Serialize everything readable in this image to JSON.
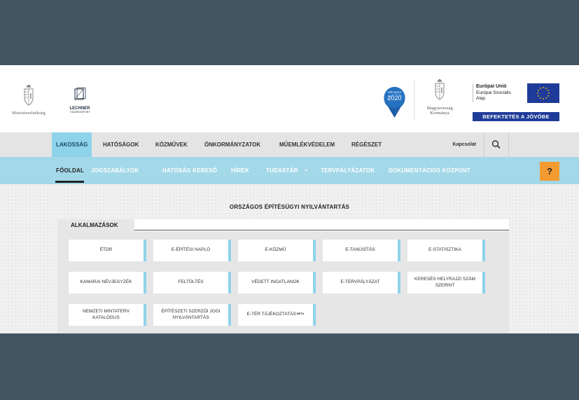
{
  "header": {
    "ministry_label": "Miniszterelnökség",
    "lechner_label": "LECHNER",
    "lechner_sub": "TUDÁSKÖZPONT",
    "szechenyi_label": "SZÉCHENYI",
    "szechenyi_year": "2020",
    "gov_label_1": "Magyarország",
    "gov_label_2": "Kormánya",
    "eu_title": "Európai Unió",
    "eu_line2": "Európai Szociális",
    "eu_line3": "Alap",
    "eu_banner": "BEFEKTETÉS A JÖVŐBE"
  },
  "topnav": {
    "items": [
      "LAKOSSÁG",
      "HATÓSÁGOK",
      "KÖZMŰVEK",
      "ÖNKORMÁNYZATOK",
      "MŰEMLÉKVÉDELEM",
      "RÉGÉSZET"
    ],
    "contact": "Kapcsolat"
  },
  "subnav": {
    "items": [
      "FŐOLDAL",
      "JOGSZABÁLYOK",
      "HATÓSÁG KERESŐ",
      "HÍREK",
      "TUDÁSTÁR",
      "TERVPÁLYÁZATOK",
      "DOKUMENTÁCIÓS KÖZPONT"
    ],
    "tudastar_chevron": "⌄",
    "help": "?"
  },
  "main": {
    "title": "ORSZÁGOS ÉPÍTÉSÜGYI NYILVÁNTARTÁS",
    "tab": "ALKALMAZÁSOK",
    "apps": [
      [
        "ÉTDR",
        "E-ÉPÍTÉSI NAPLÓ",
        "E-KÖZMŰ",
        "E-TANÚSÍTÁS",
        "E-STATISZTIKA"
      ],
      [
        "KAMARAI NÉVJEGYZÉK",
        "FELTÖLTÉS",
        "VÉDETT INGATLANOK",
        "E-TERVPÁLYÁZAT",
        "KERESÉS HELYRAJZI SZÁM SZERINT"
      ],
      [
        "NEMZETI MINTATERV KATALÓGUS",
        "ÉPÍTÉSZETI SZERZŐI JOGI NYILVÁNTARTÁS",
        "E-TÉR TÁJÉKOZTATÁS"
      ]
    ],
    "beta": "BÉTA"
  },
  "colors": {
    "accent": "#8ed3ea",
    "subnav": "#a3d8e8",
    "help": "#f39a31",
    "eu_blue": "#1f3b99",
    "frame": "#435561"
  },
  "icons": [
    "crest-icon",
    "lechner-logo-icon",
    "location-pin-icon",
    "eu-flag-icon",
    "search-icon",
    "chevron-down-icon"
  ]
}
